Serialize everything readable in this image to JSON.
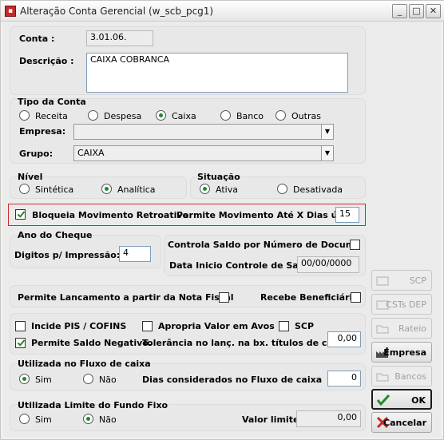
{
  "window": {
    "title": "Alteração Conta Gerencial (w_scb_pcg1)"
  },
  "conta": {
    "label": "Conta :",
    "value": "3.01.06."
  },
  "descricao": {
    "label": "Descrição :",
    "value": "CAIXA COBRANCA"
  },
  "tipo": {
    "label": "Tipo da Conta",
    "options": [
      "Receita",
      "Despesa",
      "Caixa",
      "Banco",
      "Outras"
    ],
    "selected": "Caixa"
  },
  "empresa": {
    "label": "Empresa:",
    "value": ""
  },
  "grupo": {
    "label": "Grupo:",
    "value": "CAIXA"
  },
  "nivel": {
    "label": "Nível",
    "options": [
      "Sintética",
      "Analítica"
    ],
    "selected": "Analítica"
  },
  "situacao": {
    "label": "Situação",
    "options": [
      "Ativa",
      "Desativada"
    ],
    "selected": "Ativa"
  },
  "bloqueia": {
    "label": "Bloqueia Movimento Retroativo",
    "checked": true,
    "dias_label": "Permite Movimento Até X Dias úteis",
    "dias_value": "15"
  },
  "cheque": {
    "label": "Ano do Cheque",
    "digitos_label": "Digitos p/ Impressão:",
    "digitos_value": "4",
    "controla_label": "Controla  Saldo por Número de Docum.",
    "data_label": "Data Inicio Controle de Saldo",
    "data_value": "00/00/0000"
  },
  "nota": {
    "lancamento_label": "Permite Lancamento a partir da Nota Fiscal",
    "beneficiario_label": "Recebe Beneficiário"
  },
  "impostos": {
    "pis_label": "Incide PIS / COFINS",
    "apropria_label": "Apropria Valor em Avos",
    "scp_label": "SCP",
    "saldo_neg_label": "Permite Saldo Negativo.",
    "tolerancia_label": "Tolerância no lanç. na bx. títulos de cartão:",
    "tolerancia_value": "0,00"
  },
  "fluxo": {
    "label": "Utilizada no Fluxo de caixa",
    "sim": "Sim",
    "nao": "Não",
    "selected": "Sim",
    "dias_label": "Dias considerados no Fluxo de caixa",
    "dias_value": "0"
  },
  "limite": {
    "label": "Utilizada Limite do Fundo Fixo",
    "sim": "Sim",
    "nao": "Não",
    "selected": "Não",
    "valor_label": "Valor limite:",
    "valor_value": "0,00"
  },
  "buttons": {
    "scp": "SCP",
    "csts": "CSTs DEP",
    "rateio": "Rateio",
    "empresa": "Empresa",
    "bancos": "Bancos",
    "ok": "OK",
    "cancelar": "Cancelar"
  },
  "colors": {
    "accent_green": "#1f8a2a",
    "highlight_red": "#cc2a2a"
  }
}
